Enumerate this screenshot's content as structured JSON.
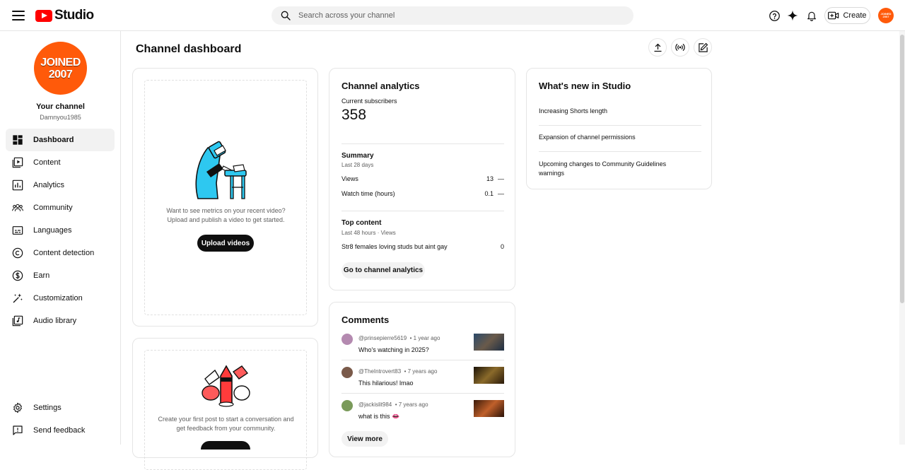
{
  "app": {
    "logo_text": "Studio"
  },
  "search": {
    "placeholder": "Search across your channel"
  },
  "header": {
    "create_label": "Create",
    "avatar_text": "JOINED 2007"
  },
  "channel": {
    "avatar_line1": "JOINED",
    "avatar_line2": "2007",
    "title": "Your channel",
    "handle": "Damnyou1985"
  },
  "sidebar": {
    "items": [
      {
        "label": "Dashboard",
        "icon": "dashboard-icon"
      },
      {
        "label": "Content",
        "icon": "content-icon"
      },
      {
        "label": "Analytics",
        "icon": "analytics-icon"
      },
      {
        "label": "Community",
        "icon": "community-icon"
      },
      {
        "label": "Languages",
        "icon": "subtitles-icon"
      },
      {
        "label": "Content detection",
        "icon": "copyright-icon"
      },
      {
        "label": "Earn",
        "icon": "dollar-icon"
      },
      {
        "label": "Customization",
        "icon": "magic-wand-icon"
      },
      {
        "label": "Audio library",
        "icon": "audio-library-icon"
      }
    ],
    "bottom": [
      {
        "label": "Settings",
        "icon": "gear-icon"
      },
      {
        "label": "Send feedback",
        "icon": "feedback-icon"
      }
    ]
  },
  "main": {
    "title": "Channel dashboard"
  },
  "upload_card": {
    "line1": "Want to see metrics on your recent video?",
    "line2": "Upload and publish a video to get started.",
    "button": "Upload videos"
  },
  "post_card": {
    "line1": "Create your first post to start a conversation and",
    "line2": "get feedback from your community."
  },
  "analytics": {
    "title": "Channel analytics",
    "subs_label": "Current subscribers",
    "subs_value": "358",
    "summary_title": "Summary",
    "summary_period": "Last 28 days",
    "rows": [
      {
        "label": "Views",
        "value": "13",
        "trend": "—"
      },
      {
        "label": "Watch time (hours)",
        "value": "0.1",
        "trend": "—"
      }
    ],
    "top_title": "Top content",
    "top_period": "Last 48 hours · Views",
    "top_item": "Str8 females loving studs but aint gay",
    "top_value": "0",
    "button": "Go to channel analytics"
  },
  "whats_new": {
    "title": "What's new in Studio",
    "items": [
      "Increasing Shorts length",
      "Expansion of channel permissions",
      "Upcoming changes to Community Guidelines warnings"
    ]
  },
  "comments": {
    "title": "Comments",
    "items": [
      {
        "author": "@prinsepierre5619",
        "time": "• 1 year ago",
        "text": "Who's watching in 2025?"
      },
      {
        "author": "@TheIntrovert83",
        "time": "• 7 years ago",
        "text": "This hilarious! lmao"
      },
      {
        "author": "@jackislit984",
        "time": "• 7 years ago",
        "text": "what is this 👄"
      }
    ],
    "button": "View more"
  },
  "colors": {
    "brand_red": "#ff0000",
    "avatar_orange": "#ff5a0a",
    "text": "#0f0f0f",
    "muted": "#606060"
  }
}
